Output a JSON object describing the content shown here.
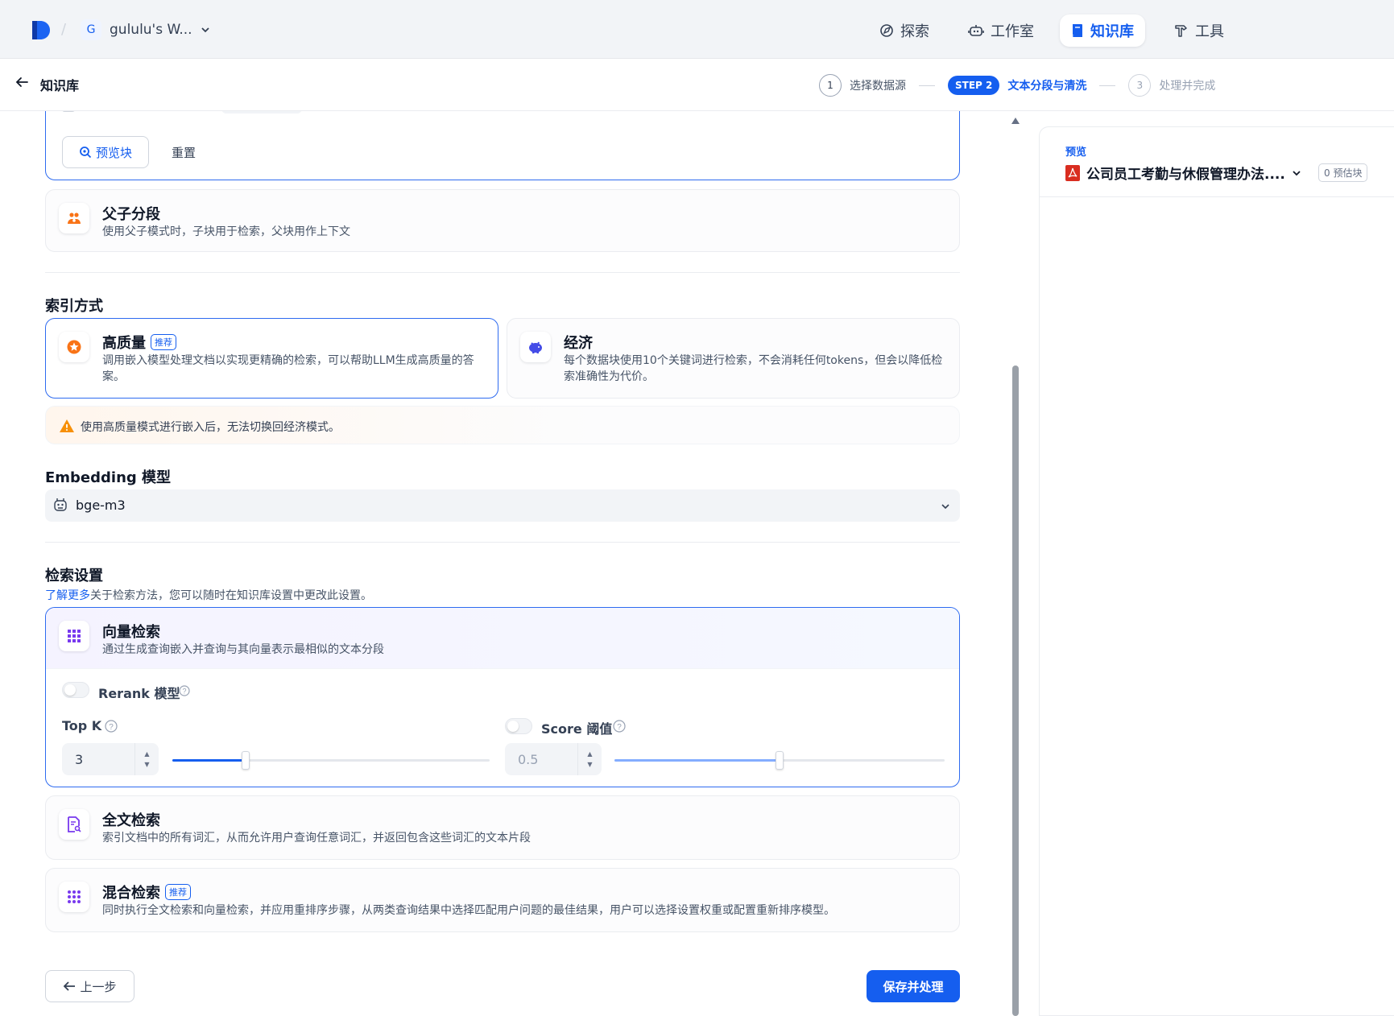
{
  "topbar": {
    "workspace_initial": "G",
    "workspace_name": "gululu's W...",
    "nav": [
      {
        "label": "探索",
        "icon": "compass-icon"
      },
      {
        "label": "工作室",
        "icon": "robot-icon"
      },
      {
        "label": "知识库",
        "icon": "book-icon",
        "active": true
      },
      {
        "label": "工具",
        "icon": "hammer-icon"
      }
    ]
  },
  "subheader": {
    "title": "知识库",
    "steps": [
      {
        "num": "1",
        "label": "选择数据源"
      },
      {
        "pill": "STEP 2",
        "label": "文本分段与清洗"
      },
      {
        "num": "3",
        "label": "处理并完成"
      }
    ]
  },
  "general_block": {
    "preview_button": "预览块",
    "reset_button": "重置"
  },
  "parent_child": {
    "title": "父子分段",
    "desc": "使用父子模式时，子块用于检索，父块用作上下文"
  },
  "index_method": {
    "title": "索引方式",
    "high_quality": {
      "title": "高质量",
      "badge": "推荐",
      "desc": "调用嵌入模型处理文档以实现更精确的检索，可以帮助LLM生成高质量的答案。"
    },
    "economy": {
      "title": "经济",
      "desc": "每个数据块使用10个关键词进行检索，不会消耗任何tokens，但会以降低检索准确性为代价。"
    },
    "warning": "使用高质量模式进行嵌入后，无法切换回经济模式。"
  },
  "embedding": {
    "title": "Embedding 模型",
    "model": "bge-m3"
  },
  "retrieval": {
    "title": "检索设置",
    "learn_more": "了解更多",
    "desc": "关于检索方法，您可以随时在知识库设置中更改此设置。",
    "vector": {
      "title": "向量检索",
      "desc": "通过生成查询嵌入并查询与其向量表示最相似的文本分段",
      "rerank_label": "Rerank 模型",
      "topk_label": "Top K",
      "topk_value": "3",
      "topk_fraction": 0.23,
      "score_label": "Score 阈值",
      "score_value": "0.5",
      "score_fraction": 0.5
    },
    "fulltext": {
      "title": "全文检索",
      "desc": "索引文档中的所有词汇，从而允许用户查询任意词汇，并返回包含这些词汇的文本片段"
    },
    "hybrid": {
      "title": "混合检索",
      "badge": "推荐",
      "desc": "同时执行全文检索和向量检索，并应用重排序步骤，从两类查询结果中选择匹配用户问题的最佳结果，用户可以选择设置权重或配置重新排序模型。"
    }
  },
  "footer": {
    "prev_button": "上一步",
    "save_button": "保存并处理"
  },
  "preview": {
    "label": "预览",
    "doc_title": "公司员工考勤与休假管理办法....",
    "chunk_count": "0 预估块"
  },
  "colors": {
    "accent": "#155eef",
    "warning": "#f79009"
  }
}
